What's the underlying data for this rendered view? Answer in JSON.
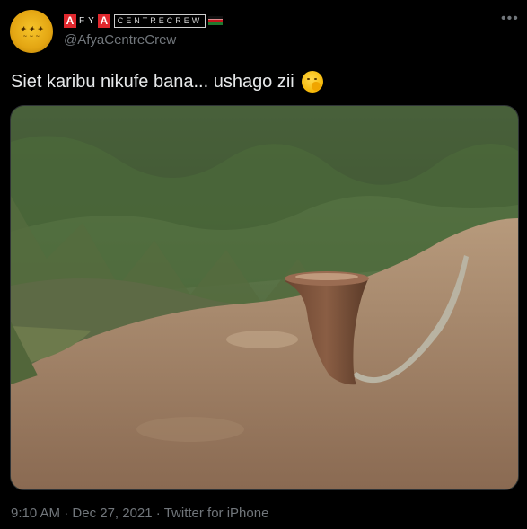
{
  "account": {
    "logo_a1": "A",
    "logo_f": "F",
    "logo_y": "Y",
    "logo_a2": "A",
    "logo_rest": "CENTRECREW",
    "handle": "@AfyaCentreCrew"
  },
  "tweet": {
    "text": "Siet karibu nikufe bana... ushago zii"
  },
  "meta": {
    "time": "9:10 AM",
    "date": "Dec 27, 2021",
    "source": "Twitter for iPhone",
    "separator": "·"
  },
  "colors": {
    "background": "#000000",
    "text": "#e7e9ea",
    "secondary_text": "#71767b",
    "logo_red": "#e0282e"
  }
}
